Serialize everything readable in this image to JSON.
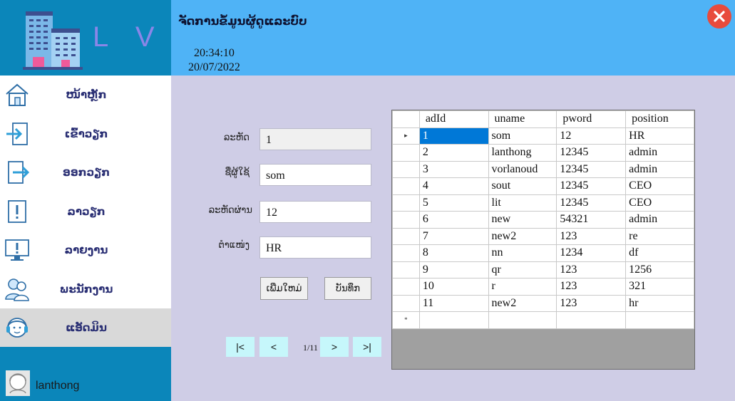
{
  "app": {
    "logo_text": "L V",
    "title": "ຈັດການຂໍ້ມູນຜູ້ດູແລະບົບ",
    "time": "20:34:10",
    "date": "20/07/2022"
  },
  "sidebar": {
    "items": [
      {
        "label": "ໜ້າຫຼັກ",
        "icon": "home-icon"
      },
      {
        "label": "ເຂົ້າວຽກ",
        "icon": "check-in-icon"
      },
      {
        "label": "ອອກວຽກ",
        "icon": "check-out-icon"
      },
      {
        "label": "ລາວຽກ",
        "icon": "leave-icon"
      },
      {
        "label": "ລາຍງານ",
        "icon": "report-icon"
      },
      {
        "label": "ພະນັກງານ",
        "icon": "employees-icon"
      },
      {
        "label": "ແອັດມິນ",
        "icon": "admin-icon"
      }
    ],
    "active_index": 6,
    "user": "lanthong"
  },
  "form": {
    "id_label": "ລະຫັດ",
    "id_value": "1",
    "user_label": "ຊື່ຜູ້ໃຊ້",
    "user_value": "som",
    "pass_label": "ລະຫັດຜ່ານ",
    "pass_value": "12",
    "pos_label": "ຕຳແໜ່ງ",
    "pos_value": "HR",
    "new_button": "ເພີ່ມໃຫມ່",
    "save_button": "ບັນທຶກ"
  },
  "pager": {
    "first": "|<",
    "prev": "<",
    "next": ">",
    "last": ">|",
    "info": "1/11"
  },
  "table": {
    "columns": [
      "adId",
      "uname",
      "pword",
      "position"
    ],
    "rows": [
      [
        "1",
        "som",
        "12",
        "HR"
      ],
      [
        "2",
        "lanthong",
        "12345",
        "admin"
      ],
      [
        "3",
        "vorlanoud",
        "12345",
        "admin"
      ],
      [
        "4",
        "sout",
        "12345",
        "CEO"
      ],
      [
        "5",
        "lit",
        "12345",
        "CEO"
      ],
      [
        "6",
        "new",
        "54321",
        "admin"
      ],
      [
        "7",
        "new2",
        "123",
        "re"
      ],
      [
        "8",
        "nn",
        "1234",
        "df"
      ],
      [
        "9",
        "qr",
        "123",
        "1256"
      ],
      [
        "10",
        "r",
        "123",
        "321"
      ],
      [
        "11",
        "new2",
        "123",
        "hr"
      ]
    ],
    "current_marker": "▸",
    "new_row_marker": "*"
  },
  "colors": {
    "header": "#4fb3f6",
    "sidebar_brand": "#0b86ba",
    "content_bg": "#cfcde6",
    "close": "#e84b3c",
    "nav_button": "#c6f7fb",
    "menu_text": "#2a2f74"
  }
}
